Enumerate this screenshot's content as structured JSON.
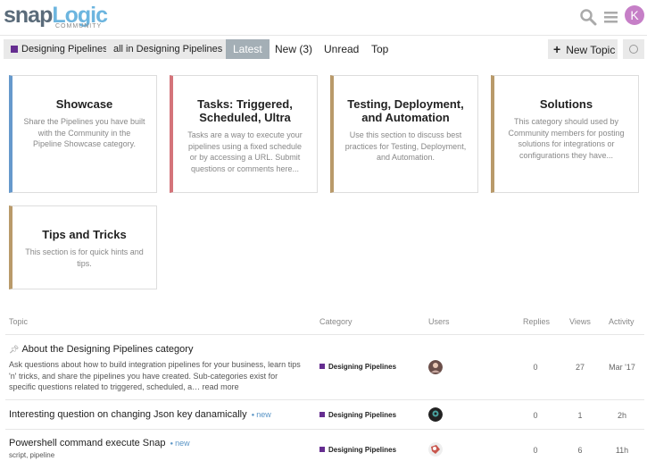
{
  "header": {
    "logo_text_a": "snap",
    "logo_text_b": "Logic",
    "logo_sub": "COMMUNITY",
    "avatar_letter": "K",
    "accent_color": "#652d90"
  },
  "nav": {
    "category_dropdown": "Designing Pipelines",
    "subcategory_dropdown": "all in Designing Pipelines",
    "tabs": [
      "Latest",
      "New (3)",
      "Unread",
      "Top"
    ],
    "new_topic": "New Topic"
  },
  "categories": [
    {
      "title": "Showcase",
      "desc": "Share the Pipelines you have built with the Community in the Pipeline Showcase category.",
      "color": "#6699cc"
    },
    {
      "title": "Tasks: Triggered, Scheduled, Ultra",
      "desc": "Tasks are a way to execute your pipelines using a fixed schedule or by accessing a URL. Submit questions or comments here...",
      "color": "#d4747a"
    },
    {
      "title": "Testing, Deployment, and Automation",
      "desc": "Use this section to discuss best practices for Testing, Deployment, and Automation.",
      "color": "#b99a6a"
    },
    {
      "title": "Solutions",
      "desc": "This category should used by Community members for posting solutions for integrations or configurations they have...",
      "color": "#b99a6a"
    },
    {
      "title": "Tips and Tricks",
      "desc": "This section is for quick hints and tips.",
      "color": "#b99a6a"
    }
  ],
  "topic_list": {
    "headers": {
      "topic": "Topic",
      "category": "Category",
      "users": "Users",
      "replies": "Replies",
      "views": "Views",
      "activity": "Activity"
    },
    "topics": [
      {
        "title": "About the Designing Pipelines category",
        "excerpt": "Ask questions about how to build integration pipelines for your business, learn tips 'n' tricks, and share the pipelines you have created. Sub-categories exist for specific questions related to triggered, scheduled, a…",
        "more": "read more",
        "category": "Designing Pipelines",
        "replies": "0",
        "views": "27",
        "activity": "Mar '17"
      },
      {
        "title": "Interesting question on changing Json key danamically",
        "badge": "new",
        "category": "Designing Pipelines",
        "replies": "0",
        "views": "1",
        "activity": "2h"
      },
      {
        "title": "Powershell command execute Snap",
        "badge": "new",
        "tags": "script, pipeline",
        "category": "Designing Pipelines",
        "replies": "0",
        "views": "6",
        "activity": "11h"
      }
    ]
  }
}
